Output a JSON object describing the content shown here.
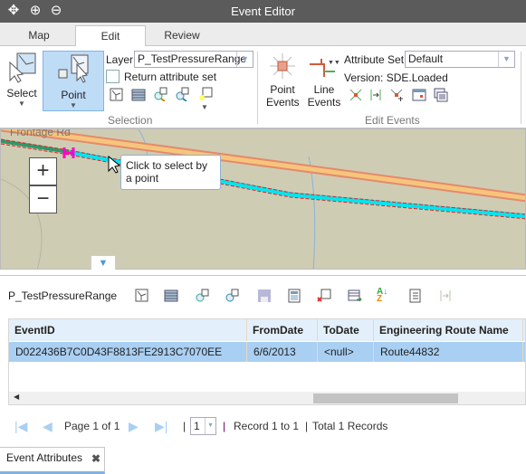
{
  "window": {
    "title": "Event Editor",
    "toolbar_icons": [
      "pan-icon",
      "zoom-in-icon",
      "zoom-out-icon"
    ]
  },
  "tabs": [
    {
      "label": "Map"
    },
    {
      "label": "Edit",
      "active": true
    },
    {
      "label": "Review"
    }
  ],
  "ribbon": {
    "selection": {
      "group_label": "Selection",
      "select_label": "Select",
      "point_label": "Point",
      "layer_label": "Layer:",
      "layer_value": "P_TestPressureRange",
      "return_attr_label": "Return attribute set",
      "return_attr_checked": false
    },
    "edit_events": {
      "group_label": "Edit Events",
      "point_events_label": "Point Events",
      "line_events_label": "Line Events",
      "attribute_set_label": "Attribute Set:",
      "attribute_set_value": "Default",
      "version_text": "Version: SDE.Loaded"
    }
  },
  "map": {
    "road_label": "Frontage Rd",
    "zoom_in": "+",
    "zoom_out": "−",
    "tooltip": "Click to select by a point"
  },
  "attributes": {
    "layer_name": "P_TestPressureRange",
    "columns": [
      "EventID",
      "FromDate",
      "ToDate",
      "Engineering Route Name"
    ],
    "rows": [
      [
        "D022436B7C0D43F8813FE2913C7070EE",
        "6/6/2013",
        "<null>",
        "Route44832"
      ]
    ],
    "pager": {
      "page_text": "Page 1 of 1",
      "page_select": "1",
      "record_text": "Record 1 to 1",
      "total_text": "Total 1 Records"
    }
  },
  "bottom_tab": {
    "label": "Event Attributes"
  },
  "colors": {
    "accent": "#a9cff2",
    "titlebar": "#5b5b5b",
    "route_cyan": "#00e5f0",
    "selected_point": "#ff00cc"
  }
}
